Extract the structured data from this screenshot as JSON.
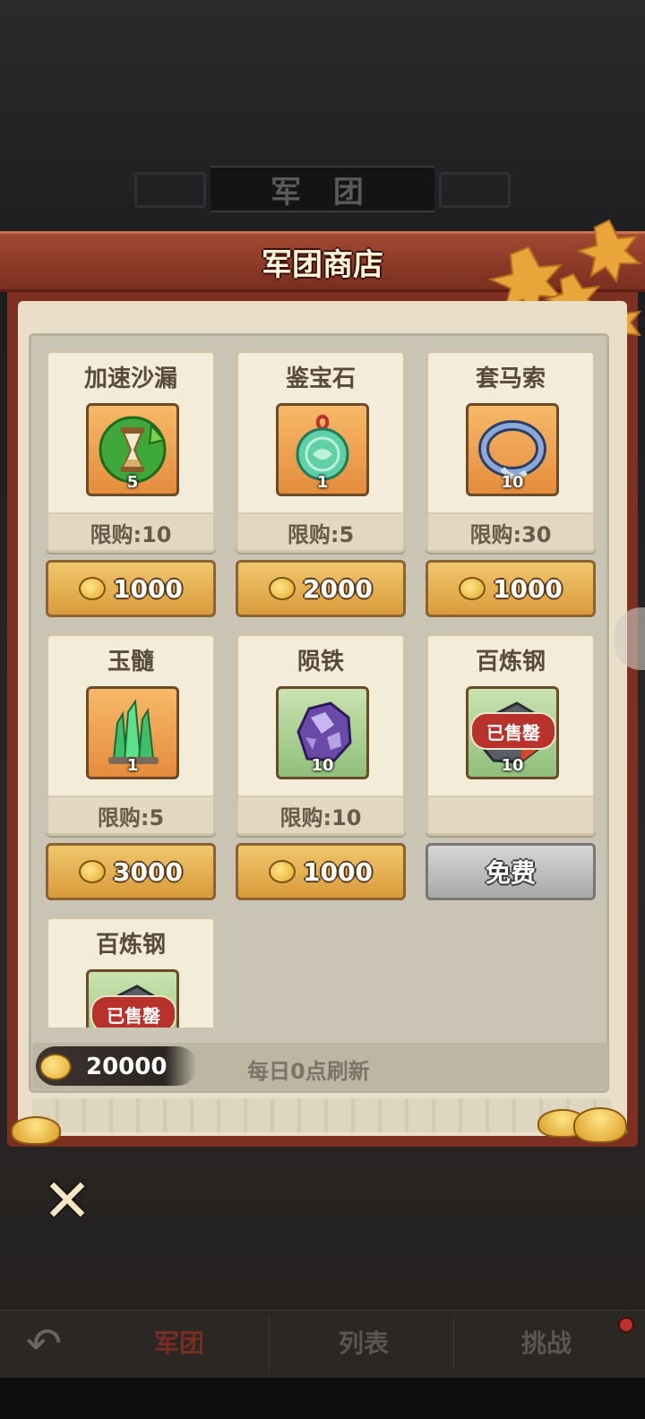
{
  "background": {
    "title": "军 团"
  },
  "panel": {
    "title": "军团商店"
  },
  "items": [
    {
      "name": "加速沙漏",
      "qty": "5",
      "limit": "限购:10",
      "price": "1000",
      "icon": "hourglass-icon",
      "sold_out": ""
    },
    {
      "name": "鉴宝石",
      "qty": "1",
      "limit": "限购:5",
      "price": "2000",
      "icon": "jade-pendant-icon",
      "sold_out": ""
    },
    {
      "name": "套马索",
      "qty": "10",
      "limit": "限购:30",
      "price": "1000",
      "icon": "lasso-icon",
      "sold_out": ""
    },
    {
      "name": "玉髓",
      "qty": "1",
      "limit": "限购:5",
      "price": "3000",
      "icon": "crystal-icon",
      "sold_out": ""
    },
    {
      "name": "陨铁",
      "qty": "10",
      "limit": "限购:10",
      "price": "1000",
      "icon": "meteorite-icon",
      "sold_out": ""
    },
    {
      "name": "百炼钢",
      "qty": "10",
      "limit": "",
      "price": "免费",
      "icon": "steel-ore-icon",
      "sold_out": "已售罄"
    },
    {
      "name": "百炼钢",
      "qty": "",
      "limit": "",
      "price": "",
      "icon": "steel-ore-icon",
      "sold_out": "已售罄"
    }
  ],
  "footer": {
    "balance": "20000",
    "refresh_note": "每日0点刷新"
  },
  "nav": {
    "tab_1": "军团",
    "tab_2": "列表",
    "tab_3": "挑战"
  },
  "colors": {
    "accent_red": "#7d3022",
    "gold_button": "#d99b3c",
    "sold_out_red": "#b8322b"
  }
}
